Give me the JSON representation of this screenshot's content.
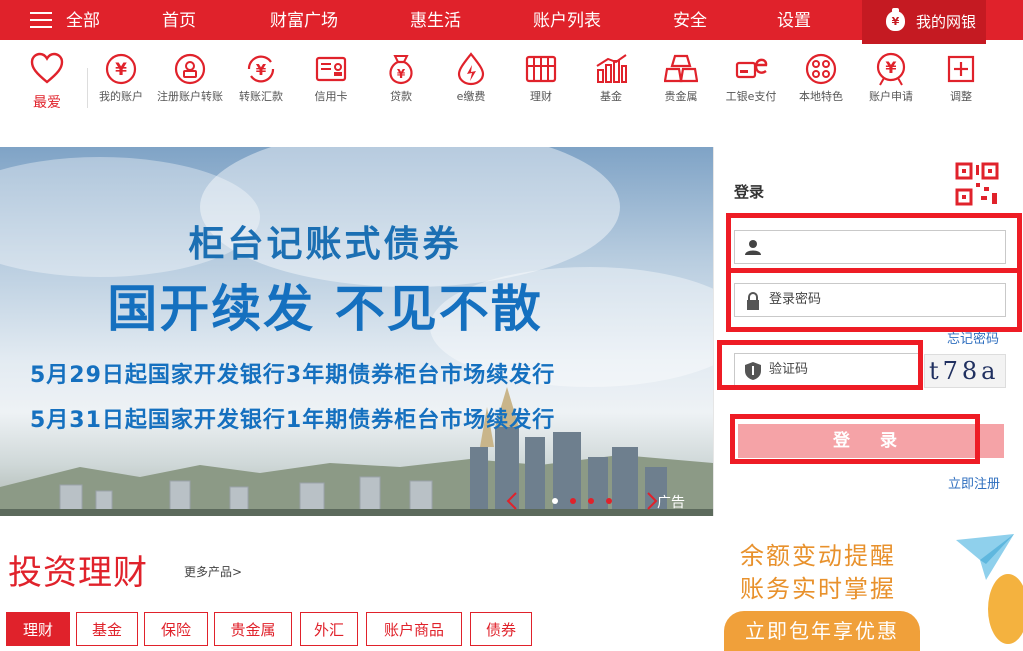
{
  "topnav": {
    "items": [
      "全部",
      "首页",
      "财富广场",
      "惠生活",
      "账户列表",
      "安全",
      "设置"
    ],
    "mybank": "我的网银"
  },
  "toolbar": {
    "fav": "最爱",
    "items": [
      {
        "label": "我的账户",
        "icon": "yen-coin-icon"
      },
      {
        "label": "注册账户转账",
        "icon": "register-transfer-icon"
      },
      {
        "label": "转账汇款",
        "icon": "transfer-icon"
      },
      {
        "label": "信用卡",
        "icon": "credit-card-icon"
      },
      {
        "label": "贷款",
        "icon": "money-bag-icon"
      },
      {
        "label": "e缴费",
        "icon": "flame-icon"
      },
      {
        "label": "理财",
        "icon": "abacus-icon"
      },
      {
        "label": "基金",
        "icon": "fund-chart-icon"
      },
      {
        "label": "贵金属",
        "icon": "gold-bars-icon"
      },
      {
        "label": "工银e支付",
        "icon": "e-pay-icon"
      },
      {
        "label": "本地特色",
        "icon": "local-icon"
      },
      {
        "label": "账户申请",
        "icon": "account-apply-icon"
      },
      {
        "label": "调整",
        "icon": "plus-box-icon"
      }
    ]
  },
  "banner": {
    "title": "柜台记账式债券",
    "headline": "国开续发 不见不散",
    "line1": "5月29日起国家开发银行3年期债券柜台市场续发行",
    "line2": "5月31日起国家开发银行1年期债券柜台市场续发行",
    "ad": "广告"
  },
  "login": {
    "title": "登录",
    "username_placeholder": "",
    "password_placeholder": "登录密码",
    "forgot": "忘记密码",
    "captcha_placeholder": "验证码",
    "captcha_text": "t78a",
    "login_button": "登 录",
    "register": "立即注册"
  },
  "investment": {
    "title": "投资理财",
    "more": "更多产品>",
    "tabs": [
      "理财",
      "基金",
      "保险",
      "贵金属",
      "外汇",
      "账户商品",
      "债券"
    ]
  },
  "promo": {
    "line1": "余额变动提醒",
    "line2": "账务实时掌握",
    "button": "立即包年享优惠"
  },
  "colors": {
    "brand": "#e0222b",
    "highlight": "#ee1c25",
    "link": "#2f6fbf",
    "promo": "#e8912c"
  }
}
